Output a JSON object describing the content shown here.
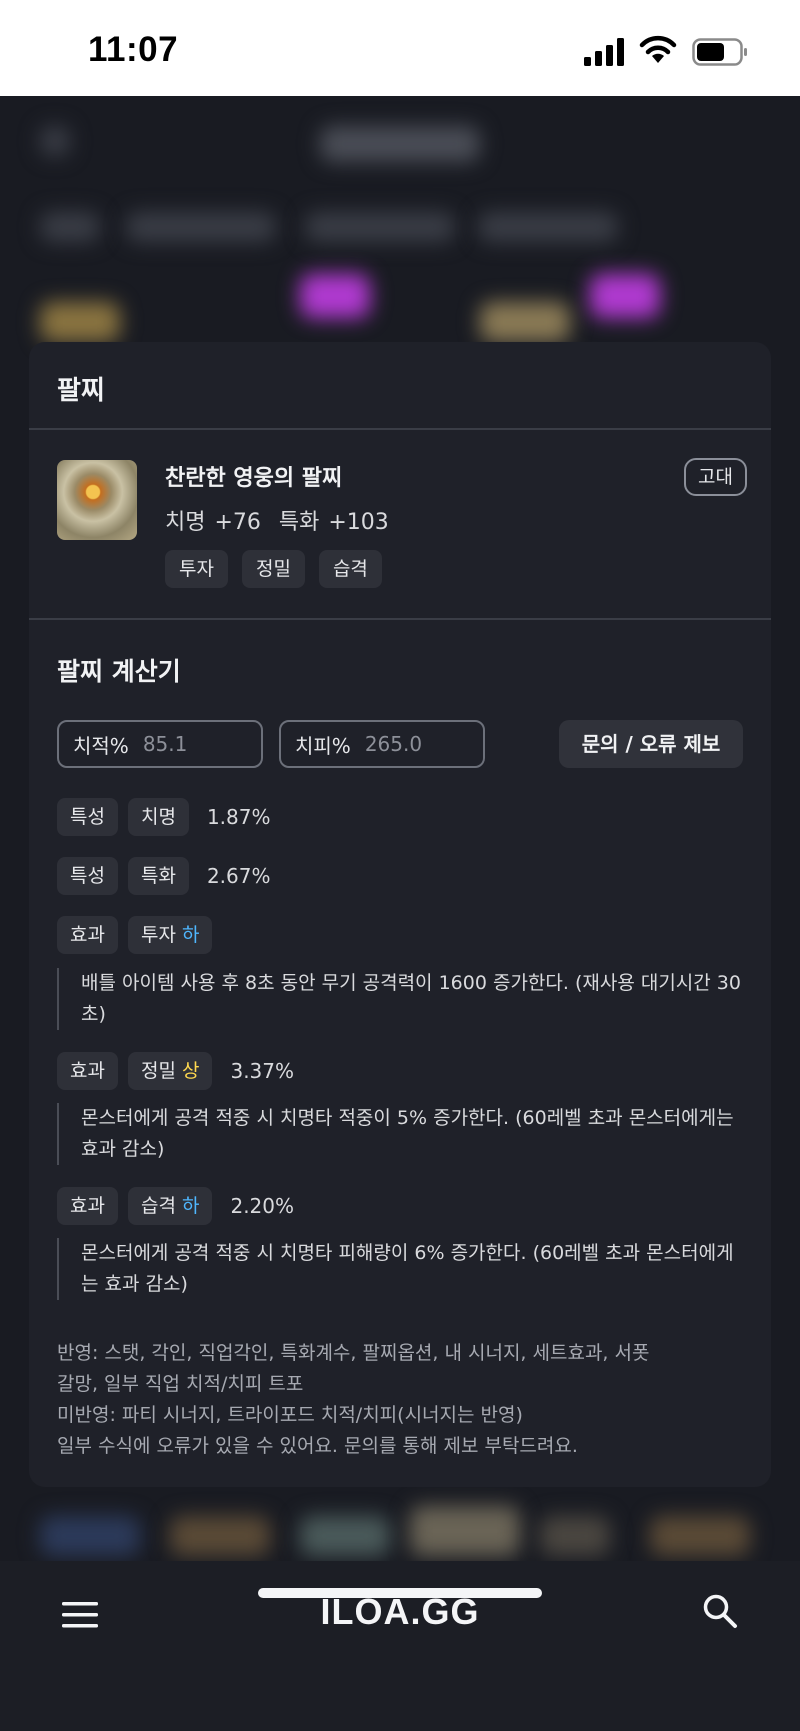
{
  "status_bar": {
    "time": "11:07"
  },
  "card": {
    "title": "팔찌",
    "item": {
      "name": "찬란한 영웅의 팔찌",
      "grade": "고대",
      "stats": "치명 +76  특화 +103",
      "tags": [
        "투자",
        "정밀",
        "습격"
      ]
    }
  },
  "calculator": {
    "title": "팔찌 계산기",
    "crit_rate_label": "치적%",
    "crit_rate_value": "85.1",
    "crit_damage_label": "치피%",
    "crit_damage_value": "265.0",
    "report_button": "문의 / 오류 제보",
    "rows": [
      {
        "type": "특성",
        "name": "치명",
        "grade": "",
        "percent": "1.87%"
      },
      {
        "type": "특성",
        "name": "특화",
        "grade": "",
        "percent": "2.67%"
      },
      {
        "type": "효과",
        "name": "투자",
        "grade": "하",
        "percent": "",
        "description": "배틀 아이템 사용 후 8초 동안 무기 공격력이 1600 증가한다. (재사용 대기시간 30초)"
      },
      {
        "type": "효과",
        "name": "정밀",
        "grade": "상",
        "percent": "3.37%",
        "description": "몬스터에게 공격 적중 시 치명타 적중이 5% 증가한다. (60레벨 초과 몬스터에게는 효과 감소)"
      },
      {
        "type": "효과",
        "name": "습격",
        "grade": "하",
        "percent": "2.20%",
        "description": "몬스터에게 공격 적중 시 치명타 피해량이 6% 증가한다. (60레벨 초과 몬스터에게는 효과 감소)"
      }
    ],
    "footnote": [
      "반영: 스탯, 각인, 직업각인, 특화계수, 팔찌옵션, 내 시너지, 세트효과, 서폿",
      "갈망, 일부 직업 치적/치피 트포",
      "미반영: 파티 시너지, 트라이포드 치적/치피(시너지는 반영)",
      "일부 수식에 오류가 있을 수 있어요. 문의를 통해 제보 부탁드려요."
    ]
  },
  "bottom_bar": {
    "brand": "ILOA.GG",
    "menu_icon": "hamburger-menu-icon",
    "search_icon": "search-icon"
  },
  "colors": {
    "grade_low": "#4fb7ff",
    "grade_high": "#ffd84f",
    "card_bg": "#1f2129"
  }
}
